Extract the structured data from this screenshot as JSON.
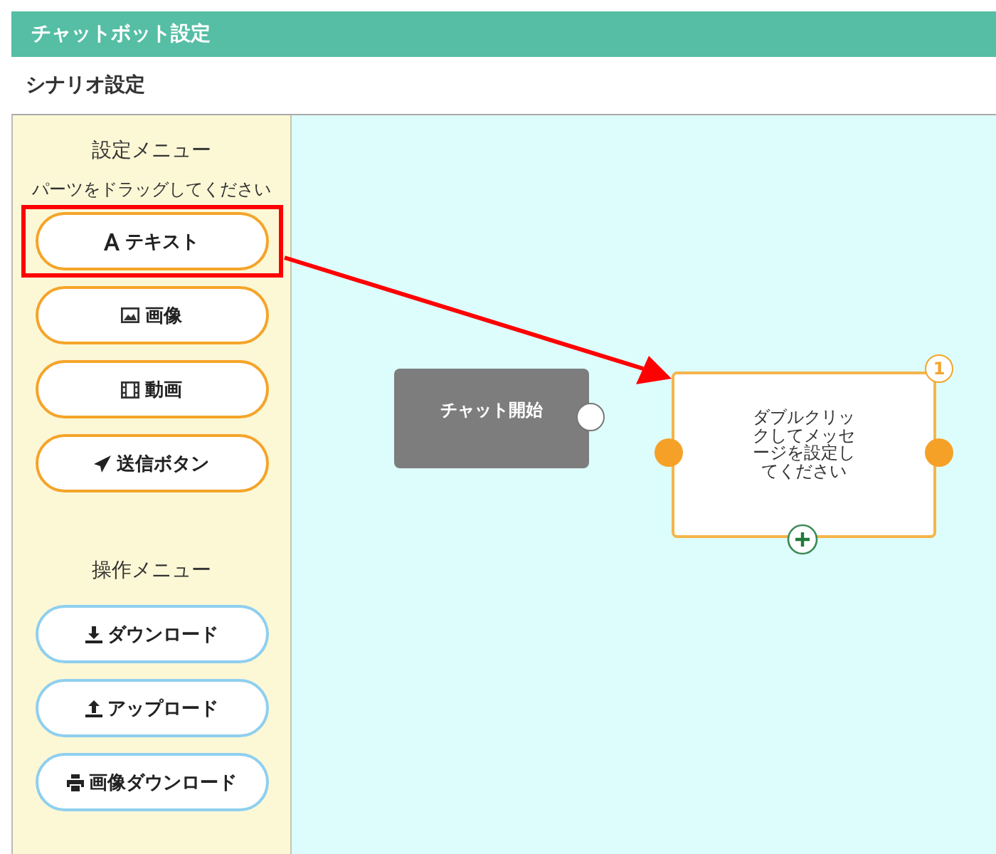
{
  "header": {
    "title": "チャットボット設定"
  },
  "subheader": {
    "title": "シナリオ設定"
  },
  "sidebar": {
    "sections": [
      {
        "kind": "parts",
        "heading": "設定メニュー",
        "hint": "パーツをドラッグしてください",
        "buttons": [
          {
            "label": "テキスト",
            "highlighted": true
          },
          {
            "label": "画像",
            "highlighted": false
          },
          {
            "label": "動画",
            "highlighted": false
          },
          {
            "label": "送信ボタン",
            "highlighted": false
          }
        ]
      },
      {
        "kind": "operation",
        "heading": "操作メニュー",
        "buttons": [
          {
            "label": "ダウンロード",
            "highlighted": false
          },
          {
            "label": "アップロード",
            "highlighted": false
          },
          {
            "label": "画像ダウンロード",
            "highlighted": false
          }
        ]
      }
    ]
  },
  "canvas": {
    "nodes": [
      {
        "kind": "start",
        "label": "チャット開始"
      },
      {
        "kind": "message",
        "label": "ダブルクリックしてメッセージを設定してください",
        "number": "1"
      }
    ]
  },
  "annotation": {
    "arrow": true
  }
}
